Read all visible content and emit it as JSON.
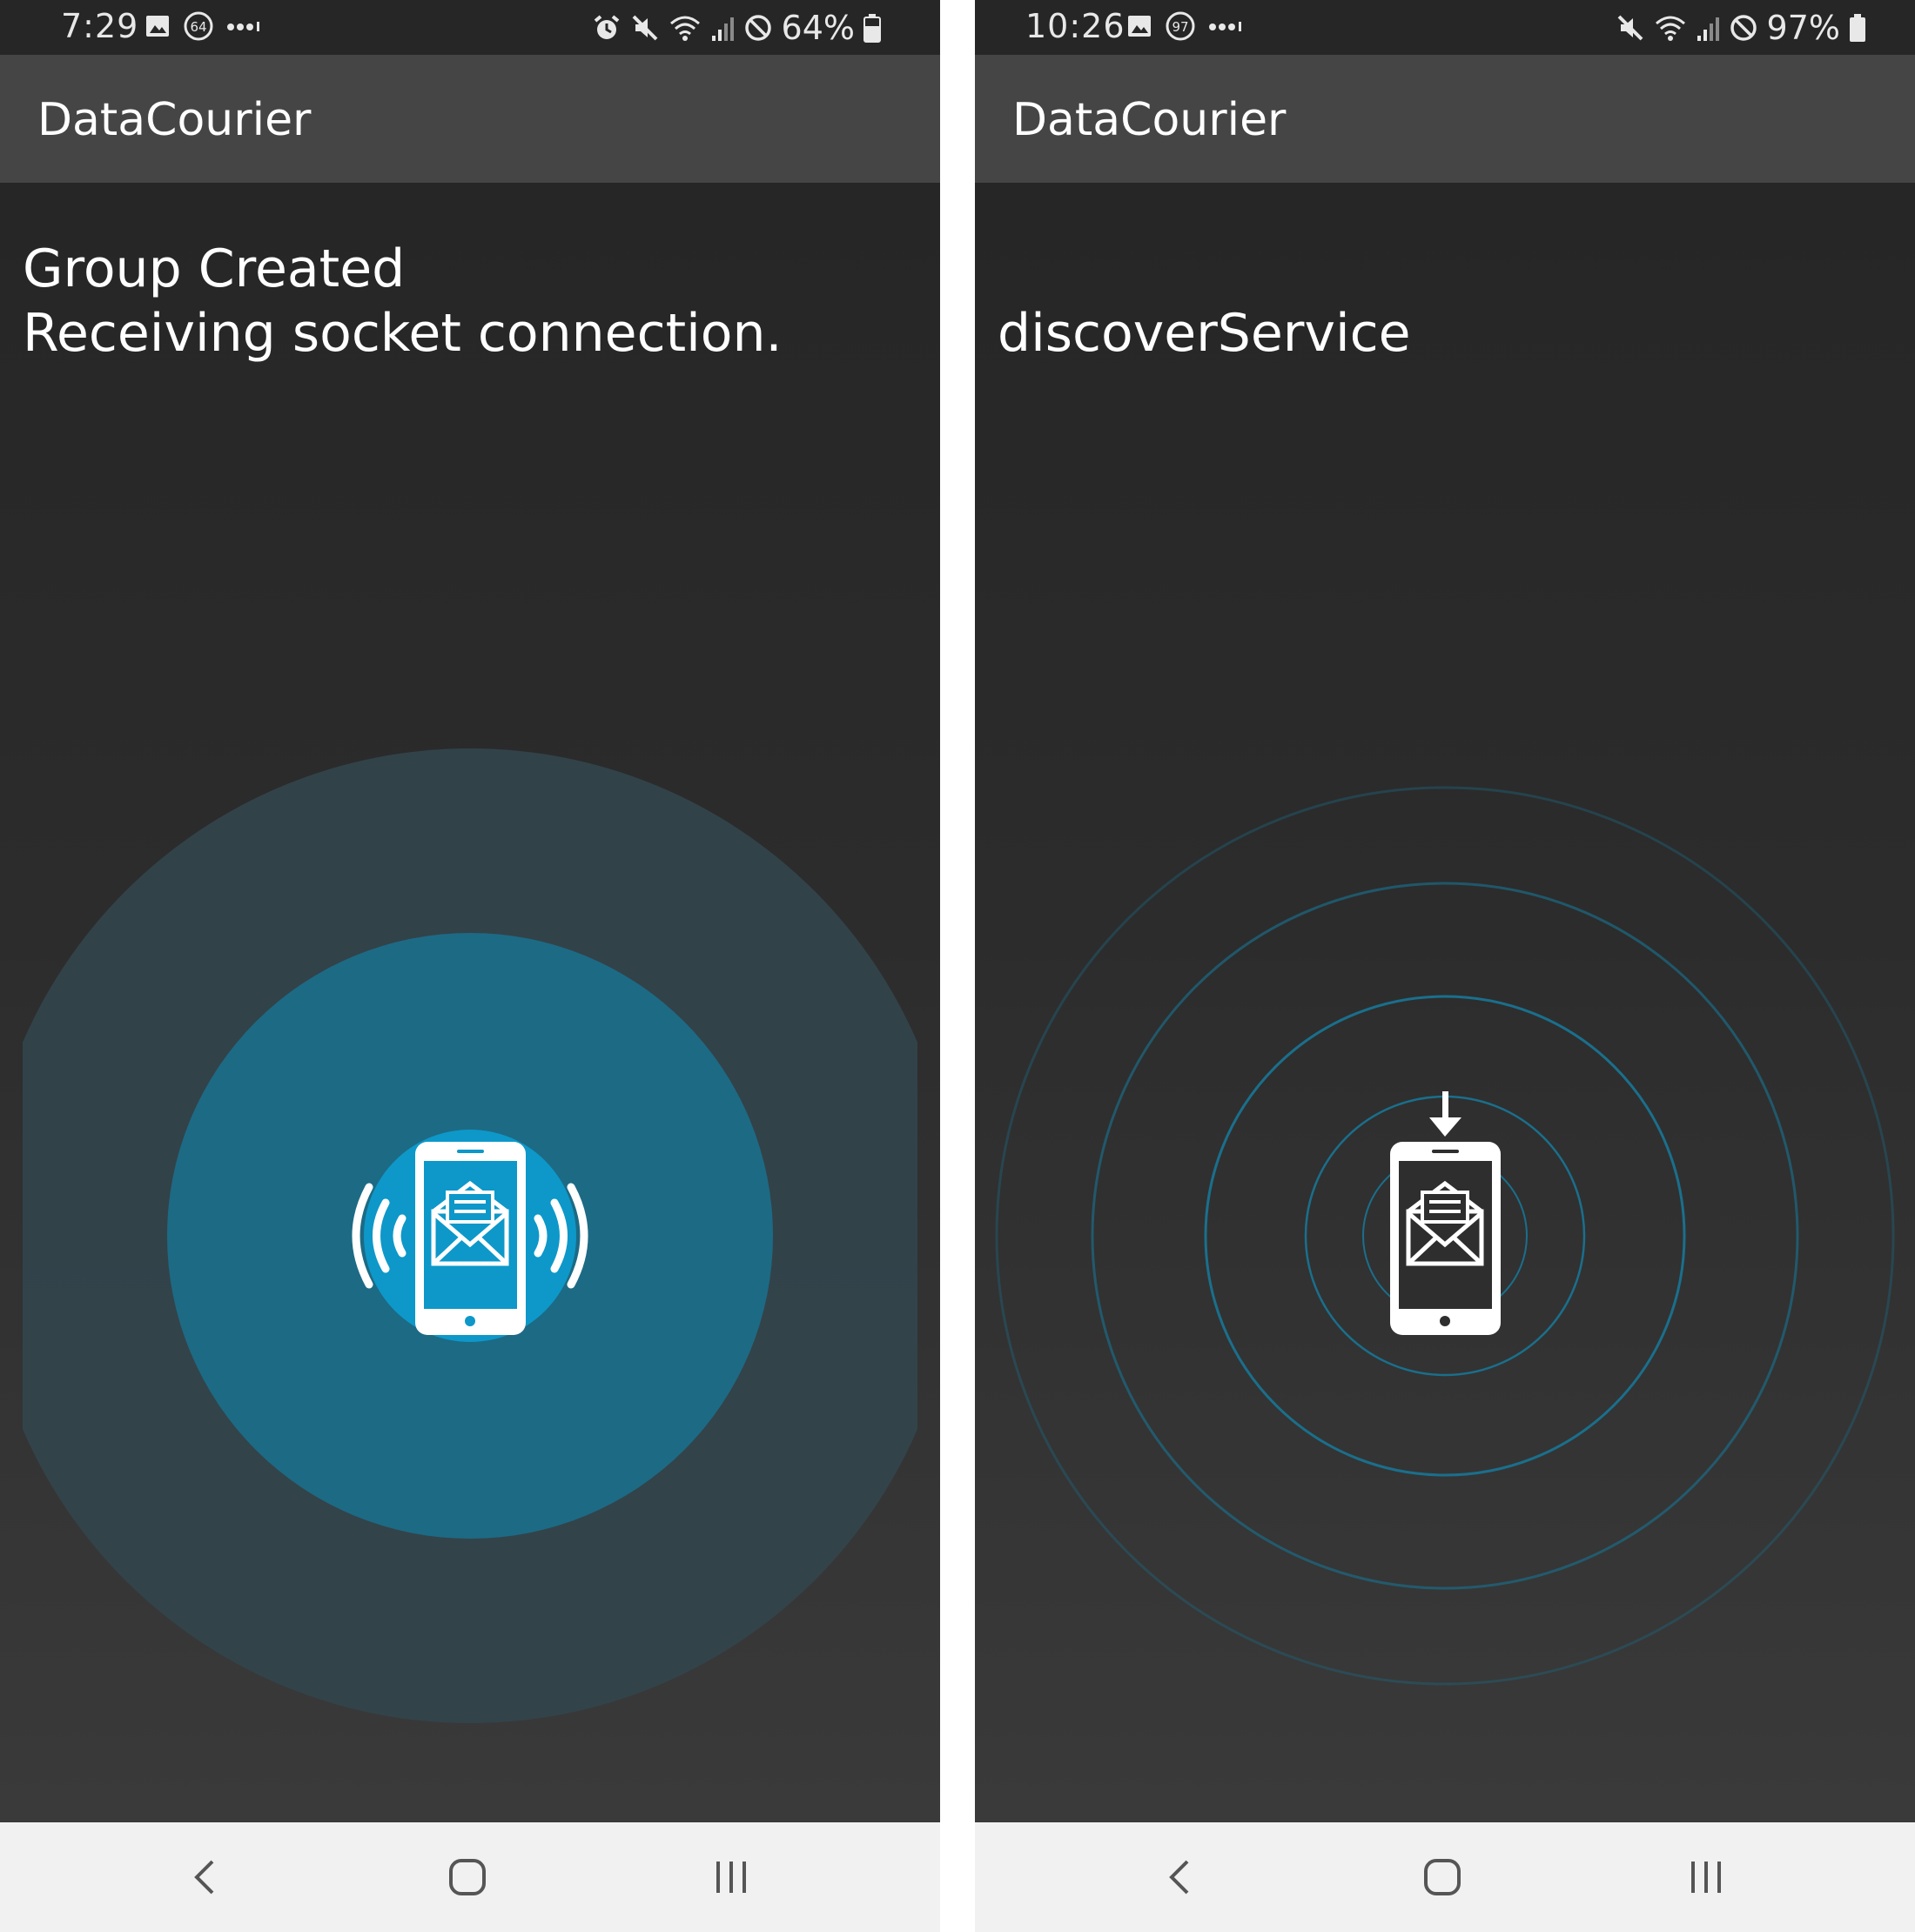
{
  "colors": {
    "accent": "#0d98c9",
    "accent_dark": "#1d6a85",
    "halo": "#33454c",
    "ring": "#1a6f8c",
    "status_bar": "#262626",
    "app_bar": "#454545",
    "nav_bar": "#f1f1f1"
  },
  "left_screen": {
    "status_bar": {
      "time": "7:29",
      "left_icons": [
        "gallery-icon",
        "notification-count-icon",
        "more-dots-icon"
      ],
      "notification_badge": "64",
      "right_icons": [
        "alarm-icon",
        "mute-icon",
        "wifi-icon",
        "signal-icon",
        "do-not-disturb-icon",
        "battery-icon"
      ],
      "battery": "64%"
    },
    "app_bar": {
      "title": "DataCourier"
    },
    "message": "Group Created\nReceiving socket connection.",
    "graphic": "phone-broadcasting-icon",
    "nav_bar": {
      "buttons": [
        "back-icon",
        "home-icon",
        "recents-icon"
      ]
    }
  },
  "right_screen": {
    "status_bar": {
      "time": "10:26",
      "left_icons": [
        "gallery-icon",
        "notification-count-icon",
        "more-dots-icon"
      ],
      "notification_badge": "97",
      "right_icons": [
        "mute-icon",
        "wifi-icon",
        "signal-icon",
        "do-not-disturb-icon",
        "battery-icon"
      ],
      "battery": "97%"
    },
    "app_bar": {
      "title": "DataCourier"
    },
    "message": "discoverService",
    "graphic": "phone-receiving-icon",
    "nav_bar": {
      "buttons": [
        "back-icon",
        "home-icon",
        "recents-icon"
      ]
    }
  }
}
